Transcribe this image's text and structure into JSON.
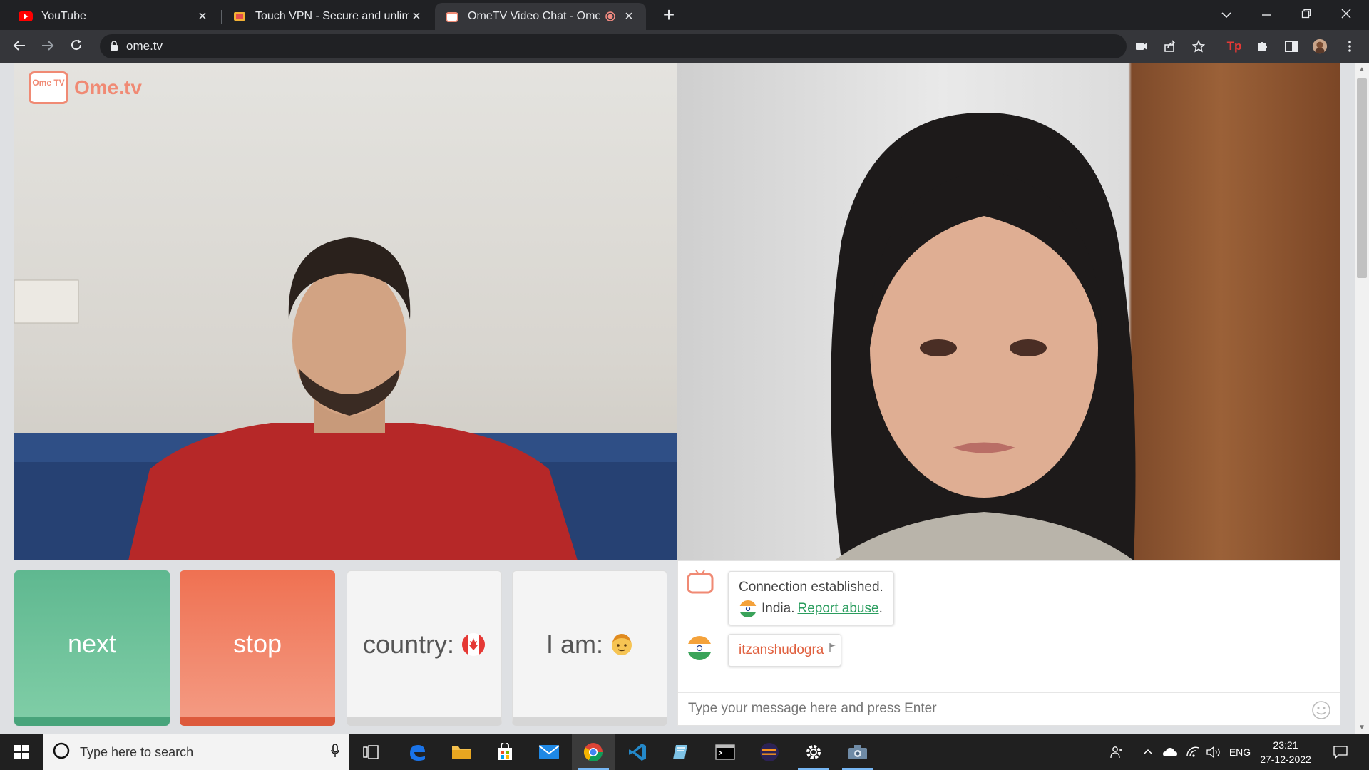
{
  "browser": {
    "tabs": [
      {
        "title": "YouTube",
        "icon": "youtube-icon",
        "active": false
      },
      {
        "title": "Touch VPN - Secure and unlimited",
        "icon": "vpn-icon",
        "active": false
      },
      {
        "title": "OmeTV Video Chat - Omegle",
        "icon": "ometv-icon",
        "active": true
      }
    ],
    "url": "ome.tv"
  },
  "app": {
    "logo_badge": "Ome TV",
    "logo_text": "Ome.tv",
    "buttons": {
      "next": "next",
      "stop": "stop",
      "country": "country:",
      "i_am": "I am:"
    },
    "chat": {
      "system_message": "Connection established.",
      "country": "India.",
      "report_link": "Report abuse",
      "report_suffix": ".",
      "partner_name": "itzanshudogra",
      "input_placeholder": "Type your message here and press Enter"
    },
    "colors": {
      "next": "#5fb890",
      "stop": "#ef7152",
      "brand": "#f08a74",
      "link": "#2a9d5e"
    }
  },
  "taskbar": {
    "search_placeholder": "Type here to search",
    "language": "ENG",
    "time": "23:21",
    "date": "27-12-2022"
  }
}
